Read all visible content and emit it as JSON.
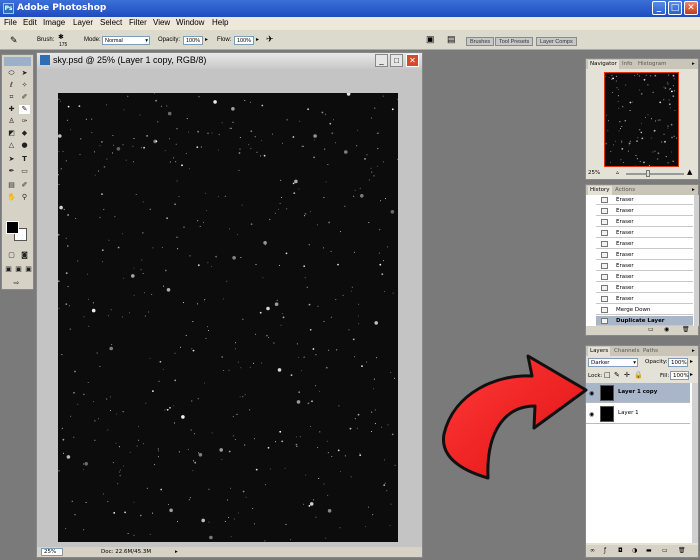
{
  "app": {
    "title": "Adobe Photoshop",
    "icon_label": "Ps"
  },
  "menu": [
    "File",
    "Edit",
    "Image",
    "Layer",
    "Select",
    "Filter",
    "View",
    "Window",
    "Help"
  ],
  "options": {
    "brush_label": "Brush:",
    "brush_size": "175",
    "mode_label": "Mode:",
    "mode_value": "Normal",
    "opacity_label": "Opacity:",
    "opacity_value": "100%",
    "flow_label": "Flow:",
    "flow_value": "100%",
    "wells": [
      "Brushes",
      "Tool Presets",
      "Layer Comps"
    ]
  },
  "document": {
    "title": "sky.psd @ 25% (Layer 1 copy, RGB/8)",
    "zoom": "25%",
    "doc_info": "Doc: 22.6M/45.3M"
  },
  "navigator": {
    "tabs": [
      "Navigator",
      "Info",
      "Histogram"
    ],
    "zoom": "25%"
  },
  "history": {
    "tabs": [
      "History",
      "Actions"
    ],
    "items": [
      "Eraser",
      "Eraser",
      "Eraser",
      "Eraser",
      "Eraser",
      "Eraser",
      "Eraser",
      "Eraser",
      "Eraser",
      "Eraser",
      "Merge Down",
      "Duplicate Layer"
    ]
  },
  "layers": {
    "tabs": [
      "Layers",
      "Channels",
      "Paths"
    ],
    "blend_mode": "Darker",
    "opacity_label": "Opacity:",
    "opacity_value": "100%",
    "lock_label": "Lock:",
    "fill_label": "Fill:",
    "fill_value": "100%",
    "items": [
      "Layer 1 copy",
      "Layer 1"
    ]
  },
  "colors": {
    "arrow": "#e01010",
    "title_bar": "#1f4bbf",
    "selected_layer": "#a9b6c9"
  }
}
